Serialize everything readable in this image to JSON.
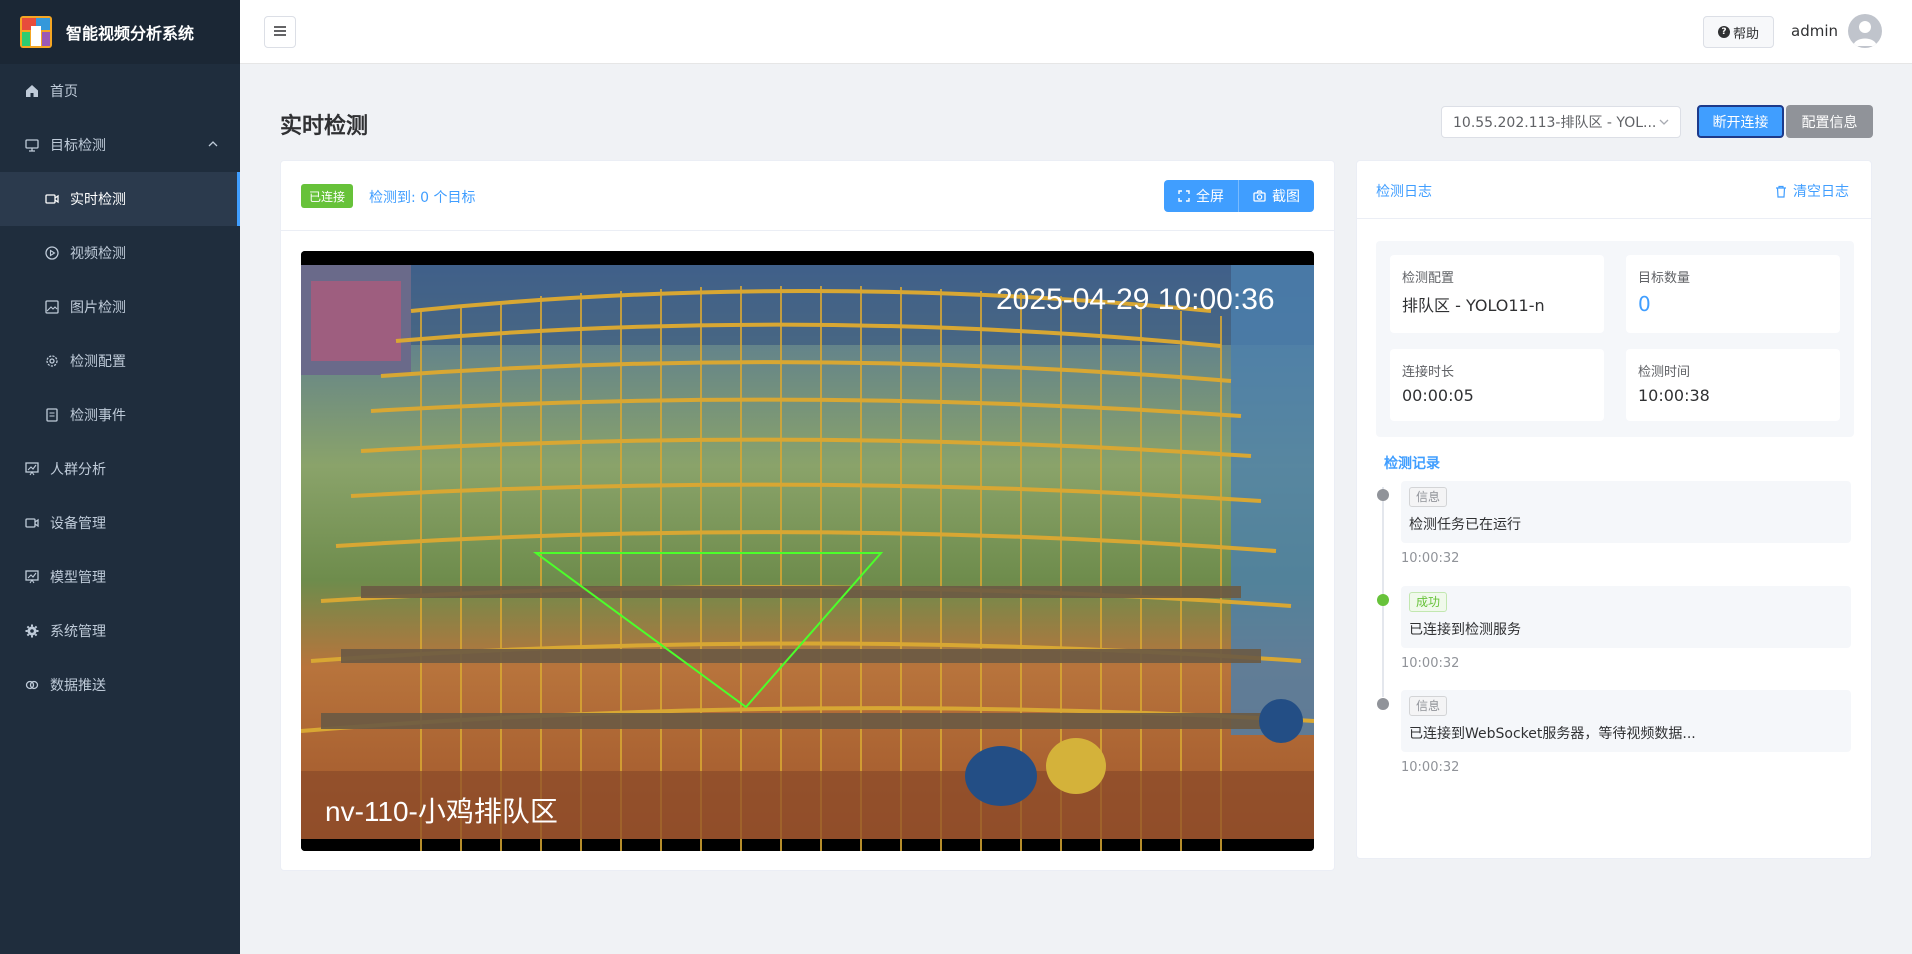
{
  "app": {
    "title": "智能视频分析系统"
  },
  "sidebar": {
    "items": [
      {
        "label": "首页",
        "icon": "home-icon"
      },
      {
        "label": "目标检测",
        "icon": "monitor-icon"
      },
      {
        "label": "实时检测",
        "icon": "video-camera-icon"
      },
      {
        "label": "视频检测",
        "icon": "play-circle-icon"
      },
      {
        "label": "图片检测",
        "icon": "image-icon"
      },
      {
        "label": "检测配置",
        "icon": "gear-icon"
      },
      {
        "label": "检测事件",
        "icon": "document-icon"
      },
      {
        "label": "人群分析",
        "icon": "chart-icon"
      },
      {
        "label": "设备管理",
        "icon": "camera-icon"
      },
      {
        "label": "模型管理",
        "icon": "chart-icon"
      },
      {
        "label": "系统管理",
        "icon": "gear-icon"
      },
      {
        "label": "数据推送",
        "icon": "link-icon"
      }
    ]
  },
  "header": {
    "help_label": "帮助",
    "username": "admin"
  },
  "page": {
    "title": "实时检测",
    "device_select": "10.55.202.113-排队区 - YOL...",
    "disconnect_label": "断开连接",
    "config_label": "配置信息"
  },
  "video": {
    "status_tag": "已连接",
    "detected_text": "检测到: 0 个目标",
    "fullscreen_label": "全屏",
    "screenshot_label": "截图",
    "timestamp_overlay": "2025-04-29 10:00:36",
    "camera_name_overlay": "nv-110-小鸡排队区"
  },
  "log": {
    "title": "检测日志",
    "clear_label": "清空日志",
    "stats": {
      "config_label": "检测配置",
      "config_value": "排队区 - YOLO11-n",
      "count_label": "目标数量",
      "count_value": "0",
      "duration_label": "连接时长",
      "duration_value": "00:00:05",
      "time_label": "检测时间",
      "time_value": "10:00:38"
    },
    "records_title": "检测记录",
    "records": [
      {
        "tag": "信息",
        "message": "检测任务已在运行",
        "time": "10:00:32"
      },
      {
        "tag": "成功",
        "message": "已连接到检测服务",
        "time": "10:00:32"
      },
      {
        "tag": "信息",
        "message": "已连接到WebSocket服务器，等待视频数据...",
        "time": "10:00:32"
      }
    ]
  }
}
